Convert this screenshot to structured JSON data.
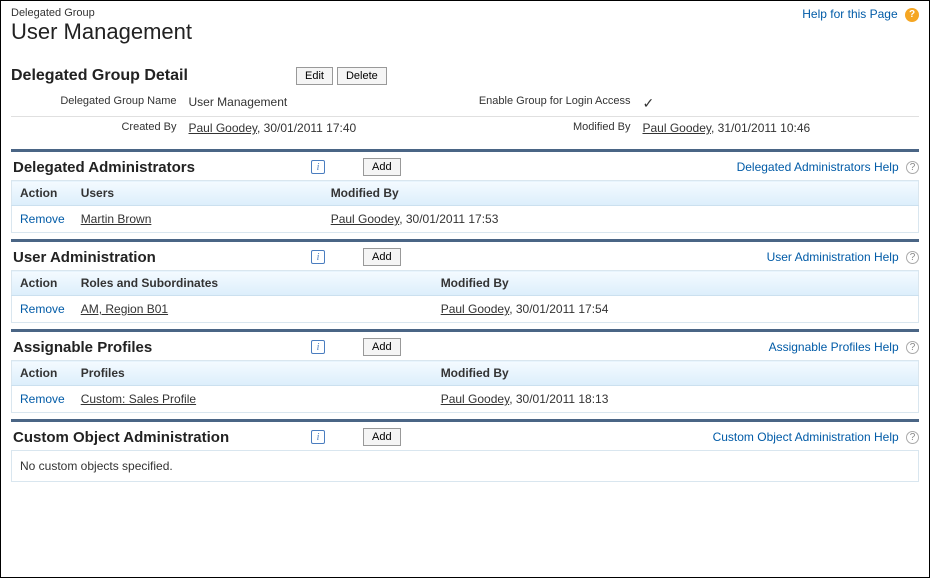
{
  "help": {
    "page_help": "Help for this Page"
  },
  "header": {
    "breadcrumb": "Delegated Group",
    "title": "User Management"
  },
  "detail": {
    "title": "Delegated Group Detail",
    "edit_label": "Edit",
    "delete_label": "Delete",
    "name_label": "Delegated Group Name",
    "name_value": "User Management",
    "login_label": "Enable Group for Login Access",
    "login_icon": "✓",
    "created_by_label": "Created By",
    "created_by_user": "Paul Goodey",
    "created_by_ts": ", 30/01/2011 17:40",
    "modified_by_label": "Modified By",
    "modified_by_user": "Paul Goodey",
    "modified_by_ts": ", 31/01/2011 10:46"
  },
  "sections": {
    "delegated_admins": {
      "title": "Delegated Administrators",
      "add_label": "Add",
      "help_label": "Delegated Administrators Help",
      "col_action": "Action",
      "col_users": "Users",
      "col_modified": "Modified By",
      "row": {
        "action": "Remove",
        "user": "Martin Brown",
        "mod_user": "Paul Goodey",
        "mod_ts": ", 30/01/2011 17:53"
      }
    },
    "user_admin": {
      "title": "User Administration",
      "add_label": "Add",
      "help_label": "User Administration Help",
      "col_action": "Action",
      "col_roles": "Roles and Subordinates",
      "col_modified": "Modified By",
      "row": {
        "action": "Remove",
        "role": "AM, Region B01",
        "mod_user": "Paul Goodey",
        "mod_ts": ", 30/01/2011 17:54"
      }
    },
    "profiles": {
      "title": "Assignable Profiles",
      "add_label": "Add",
      "help_label": "Assignable Profiles Help",
      "col_action": "Action",
      "col_profiles": "Profiles",
      "col_modified": "Modified By",
      "row": {
        "action": "Remove",
        "profile": "Custom: Sales Profile",
        "mod_user": "Paul Goodey",
        "mod_ts": ", 30/01/2011 18:13"
      }
    },
    "custom_obj": {
      "title": "Custom Object Administration",
      "add_label": "Add",
      "help_label": "Custom Object Administration Help",
      "empty_msg": "No custom objects specified."
    }
  }
}
